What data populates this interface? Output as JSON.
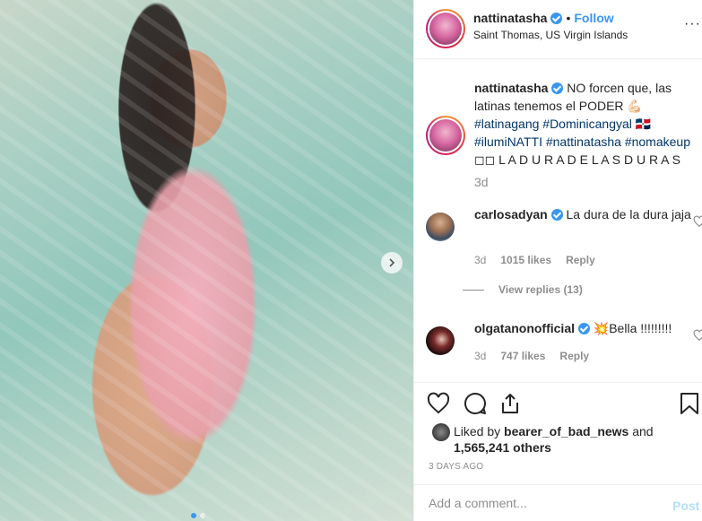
{
  "header": {
    "username": "nattinatasha",
    "separator": "•",
    "follow_label": "Follow",
    "location": "Saint Thomas, US Virgin Islands",
    "more_label": "···"
  },
  "caption": {
    "username": "nattinatasha",
    "text_part1": "NO forcen que, las latinas tenemos el PODER",
    "emoji1": "💪🏻",
    "hashtags": "#latinagang #Dominicangyal",
    "flag": "🇩🇴",
    "hashtags2": "#ilumiNATTI #nattinatasha #nomakeup",
    "tail": "◻◻ L A D U R A D E L A S D U R A S",
    "age": "3d"
  },
  "comments": [
    {
      "username": "carlosadyan",
      "text": "La dura de la dura jaja",
      "age": "3d",
      "likes": "1015 likes",
      "reply": "Reply"
    },
    {
      "username": "olgatanonofficial",
      "emoji": "💥",
      "text": "Bella !!!!!!!!!",
      "age": "3d",
      "likes": "747 likes",
      "reply": "Reply"
    }
  ],
  "view_replies": "View replies (13)",
  "likes": {
    "prefix": "Liked by ",
    "user": "bearer_of_bad_news",
    "and": " and",
    "count": "1,565,241 others"
  },
  "timestamp": "3 DAYS AGO",
  "add_comment": {
    "placeholder": "Add a comment...",
    "post_label": "Post"
  },
  "colors": {
    "accent": "#3897f0",
    "hashtag": "#003569",
    "muted": "#8e8e8e",
    "post_disabled": "#b2dffc"
  },
  "icons": [
    "chevron-right-icon",
    "heart-icon",
    "comment-icon",
    "share-icon",
    "bookmark-icon",
    "verified-badge-icon"
  ]
}
